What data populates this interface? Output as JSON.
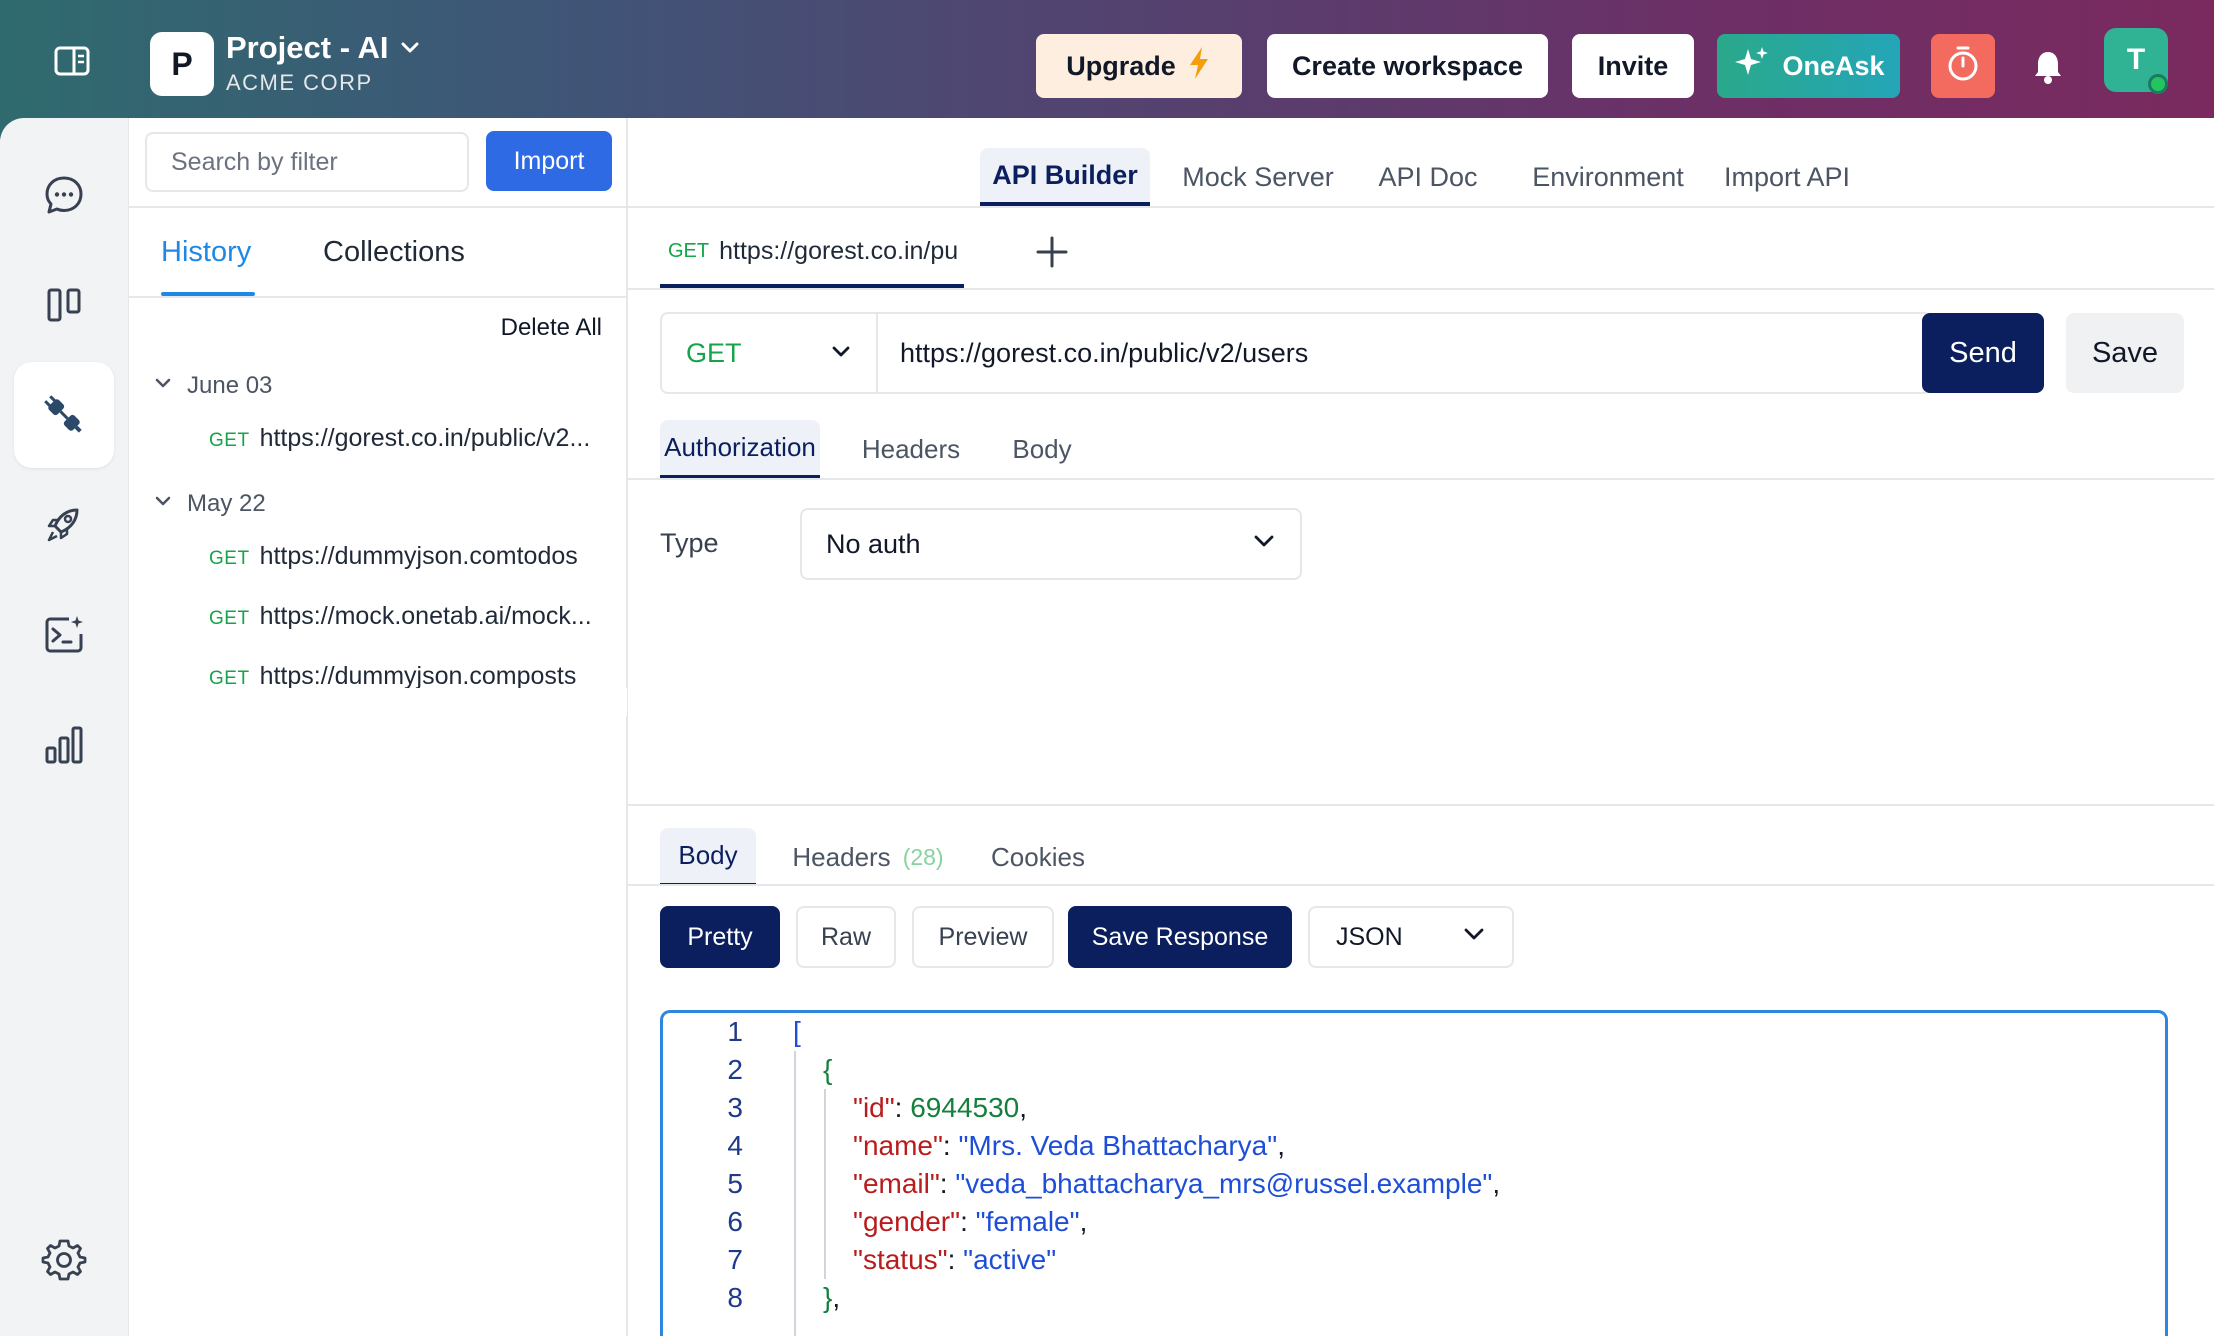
{
  "header": {
    "project_initial": "P",
    "project_name": "Project - AI",
    "org_name": "ACME CORP",
    "upgrade_label": "Upgrade",
    "create_workspace_label": "Create workspace",
    "invite_label": "Invite",
    "oneask_label": "OneAsk",
    "avatar_initial": "T",
    "colors": {
      "upgrade_bg": "#fdeee0",
      "oneask_bg": "#2aa88a",
      "timer_bg": "#f26b5e",
      "avatar_bg": "#2fb394"
    }
  },
  "rail": {
    "icons": [
      "chat-icon",
      "board-icon",
      "api-plug-icon",
      "rocket-icon",
      "terminal-sparkle-icon",
      "bar-chart-icon",
      "settings-icon"
    ],
    "active": "api-plug-icon"
  },
  "history_panel": {
    "search_placeholder": "Search by filter",
    "import_label": "Import",
    "tabs": [
      "History",
      "Collections"
    ],
    "active_tab": "History",
    "delete_all_label": "Delete All",
    "groups": [
      {
        "date": "June 03",
        "items": [
          {
            "method": "GET",
            "url": "https://gorest.co.in/public/v2..."
          }
        ]
      },
      {
        "date": "May 22",
        "items": [
          {
            "method": "GET",
            "url": "https://dummyjson.comtodos"
          },
          {
            "method": "GET",
            "url": "https://mock.onetab.ai/mock..."
          },
          {
            "method": "GET",
            "url": "https://dummyjson.composts"
          }
        ]
      }
    ]
  },
  "main": {
    "top_tabs": [
      "API Builder",
      "Mock Server",
      "API Doc",
      "Environment",
      "Import API"
    ],
    "active_top_tab": "API Builder",
    "request_tab": {
      "method": "GET",
      "url": "https://gorest.co.in/pu"
    },
    "request": {
      "method": "GET",
      "url": "https://gorest.co.in/public/v2/users",
      "send_label": "Send",
      "save_label": "Save"
    },
    "request_tabs": [
      "Authorization",
      "Headers",
      "Body"
    ],
    "active_request_tab": "Authorization",
    "auth": {
      "type_label": "Type",
      "type_value": "No auth"
    },
    "response_tabs": {
      "body": "Body",
      "headers": "Headers",
      "headers_count": "(28)",
      "cookies": "Cookies"
    },
    "response_buttons": {
      "pretty": "Pretty",
      "raw": "Raw",
      "preview": "Preview",
      "save_response": "Save Response"
    },
    "format": "JSON",
    "code": {
      "line_numbers": [
        "1",
        "2",
        "3",
        "4",
        "5",
        "6",
        "7",
        "8"
      ],
      "id_value": "6944530",
      "name_value": "\"Mrs. Veda Bhattacharya\"",
      "email_value": "\"veda_bhattacharya_mrs@russel.example\"",
      "gender_value": "\"female\"",
      "status_value": "\"active\""
    }
  }
}
